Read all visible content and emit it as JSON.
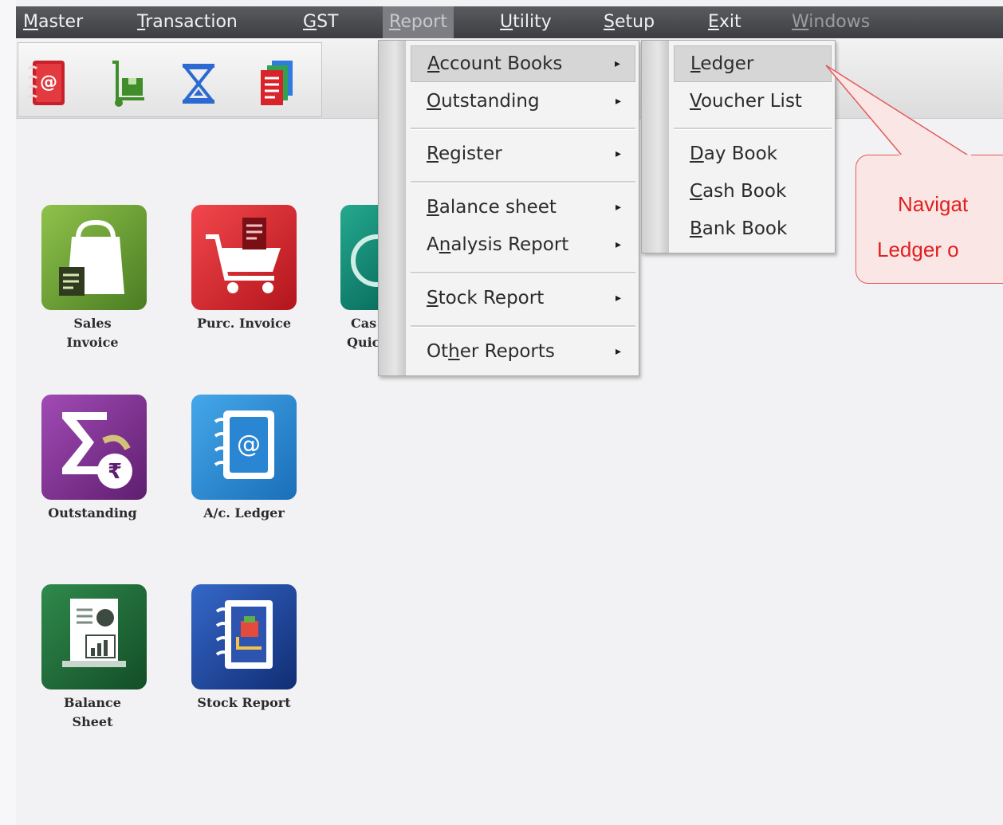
{
  "menubar": {
    "items": [
      {
        "label": "Master",
        "underline": "M",
        "rest": "aster"
      },
      {
        "label": "Transaction",
        "underline": "T",
        "rest": "ransaction"
      },
      {
        "label": "GST",
        "underline": "G",
        "rest": "ST"
      },
      {
        "label": "Report",
        "underline": "R",
        "rest": "eport"
      },
      {
        "label": "Utility",
        "underline": "U",
        "rest": "tility"
      },
      {
        "label": "Setup",
        "underline": "S",
        "rest": "etup"
      },
      {
        "label": "Exit",
        "underline": "E",
        "rest": "xit"
      },
      {
        "label": "Windows",
        "underline": "W",
        "rest": "indows"
      }
    ]
  },
  "toolbar": {
    "icons": [
      "address-book-icon",
      "delivery-trolley-icon",
      "hourglass-icon",
      "documents-icon"
    ]
  },
  "tiles": [
    {
      "label": "Sales Invoice",
      "line1": "Sales",
      "line2": "Invoice",
      "icon": "shopping-bag-icon",
      "color": "#5a8f2c"
    },
    {
      "label": "Purc. Invoice",
      "line1": "Purc. Invoice",
      "line2": "",
      "icon": "shopping-cart-icon",
      "color": "#d7232a"
    },
    {
      "label": "Cash Quick",
      "line1": "Cas",
      "line2": "Quic",
      "icon": "cash-icon",
      "color": "#0f8872"
    },
    {
      "label": "Outstanding",
      "line1": "Outstanding",
      "line2": "",
      "icon": "hourglass-rupee-icon",
      "color": "#7e2f8e"
    },
    {
      "label": "A/c. Ledger",
      "line1": "A/c. Ledger",
      "line2": "",
      "icon": "ledger-book-icon",
      "color": "#2083cf"
    },
    {
      "label": "Balance Sheet",
      "line1": "Balance",
      "line2": "Sheet",
      "icon": "balance-sheet-icon",
      "color": "#1e6b3a"
    },
    {
      "label": "Stock Report",
      "line1": "Stock Report",
      "line2": "",
      "icon": "stock-report-icon",
      "color": "#1f3f9a"
    }
  ],
  "report_menu": {
    "items": [
      {
        "pre": "",
        "u": "A",
        "post": "ccount Books",
        "submenu": true
      },
      {
        "pre": "",
        "u": "O",
        "post": "utstanding",
        "submenu": true
      },
      {
        "pre": "",
        "u": "R",
        "post": "egister",
        "submenu": true
      },
      {
        "pre": "",
        "u": "B",
        "post": "alance sheet",
        "submenu": true
      },
      {
        "pre": "A",
        "u": "n",
        "post": "alysis Report",
        "submenu": true
      },
      {
        "pre": "",
        "u": "S",
        "post": "tock Report",
        "submenu": true
      },
      {
        "pre": "Ot",
        "u": "h",
        "post": "er Reports",
        "submenu": true
      }
    ],
    "arrow": "▸"
  },
  "account_books_menu": {
    "items": [
      {
        "pre": "",
        "u": "L",
        "post": "edger"
      },
      {
        "pre": "",
        "u": "V",
        "post": "oucher List"
      },
      {
        "pre": "",
        "u": "D",
        "post": "ay Book"
      },
      {
        "pre": "",
        "u": "C",
        "post": "ash Book"
      },
      {
        "pre": "",
        "u": "B",
        "post": "ank Book"
      }
    ]
  },
  "callout": {
    "line1": "Navigat",
    "line2": "Ledger o"
  },
  "colors": {
    "menubar_bg": "#45464a",
    "callout_text": "#e0201e",
    "callout_border": "#e15b5b",
    "callout_fill": "#fbe6e6"
  }
}
